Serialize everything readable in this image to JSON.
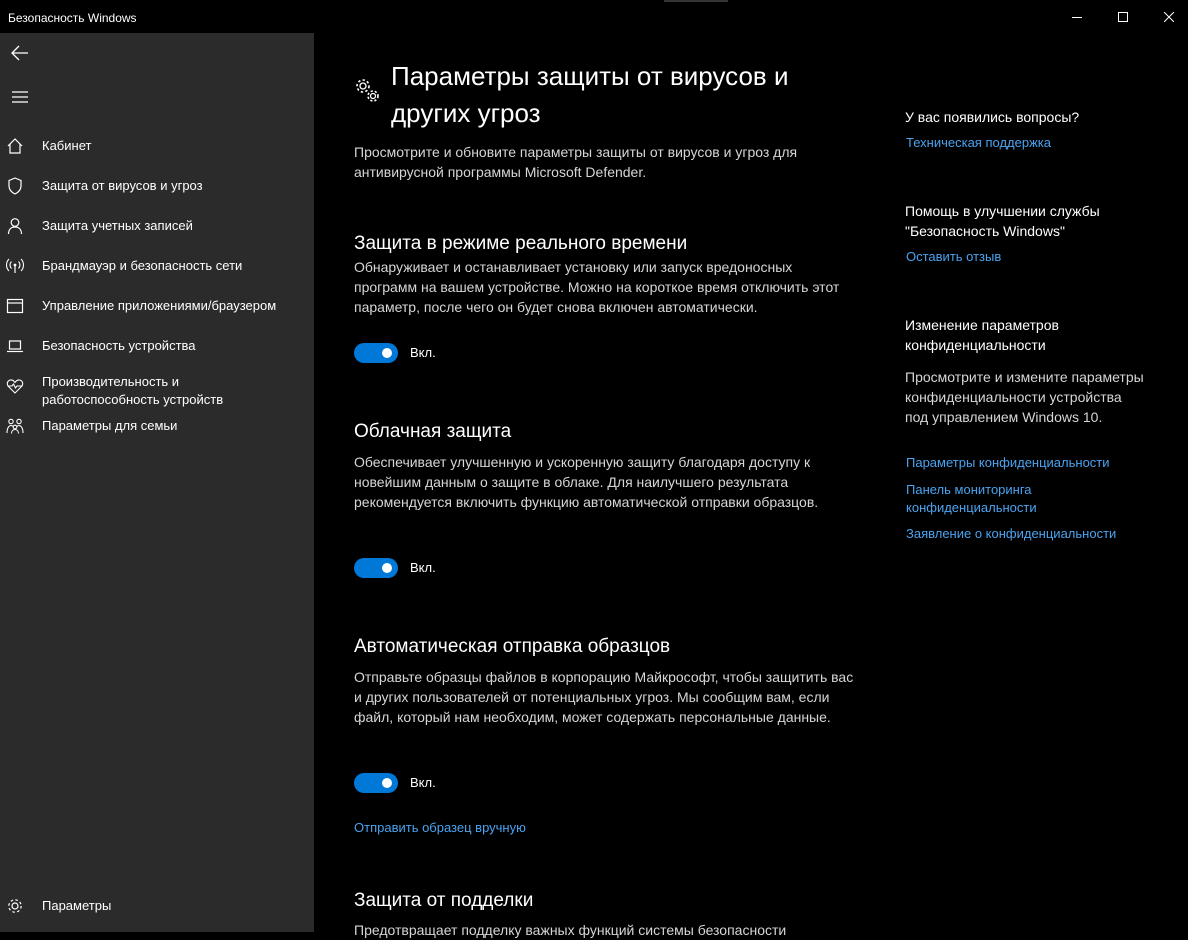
{
  "window": {
    "title": "Безопасность Windows"
  },
  "sidebar": {
    "items": [
      {
        "label": "Кабинет",
        "icon": "home-icon"
      },
      {
        "label": "Защита от вирусов и угроз",
        "icon": "shield-icon"
      },
      {
        "label": "Защита учетных записей",
        "icon": "person-icon"
      },
      {
        "label": "Брандмауэр и безопасность сети",
        "icon": "antenna-icon"
      },
      {
        "label": "Управление приложениями/браузером",
        "icon": "app-window-icon"
      },
      {
        "label": "Безопасность устройства",
        "icon": "laptop-icon"
      },
      {
        "label": "Производительность и работоспособность устройств",
        "icon": "heart-pulse-icon"
      },
      {
        "label": "Параметры для семьи",
        "icon": "family-icon"
      }
    ],
    "settings_label": "Параметры"
  },
  "main": {
    "title": "Параметры защиты от вирусов и других угроз",
    "description": "Просмотрите и обновите параметры защиты от вирусов и угроз для антивирусной программы Microsoft Defender.",
    "sections": [
      {
        "title": "Защита в режиме реального времени",
        "description": "Обнаруживает и останавливает установку или запуск вредоносных программ на вашем устройстве. Можно на короткое время отключить этот параметр, после чего он будет снова включен автоматически.",
        "toggle_label": "Вкл."
      },
      {
        "title": "Облачная защита",
        "description": "Обеспечивает улучшенную и ускоренную защиту благодаря доступу к новейшим данным о защите в облаке. Для наилучшего результата рекомендуется включить функцию автоматической отправки образцов.",
        "toggle_label": "Вкл."
      },
      {
        "title": "Автоматическая отправка образцов",
        "description": "Отправьте образцы файлов в корпорацию Майкрософт, чтобы защитить вас и других пользователей от потенциальных угроз. Мы сообщим вам, если файл, который нам необходим, может содержать персональные данные.",
        "toggle_label": "Вкл.",
        "link": "Отправить образец вручную"
      },
      {
        "title": "Защита от подделки",
        "description": "Предотвращает подделку важных функций системы безопасности"
      }
    ]
  },
  "right": {
    "questions_head": "У вас появились вопросы?",
    "support_link": "Техническая поддержка",
    "improve_head": "Помощь в улучшении службы \"Безопасность Windows\"",
    "feedback_link": "Оставить отзыв",
    "privacy_head": "Изменение параметров конфиденциальности",
    "privacy_text": "Просмотрите и измените параметры конфиденциальности устройства под управлением Windows 10.",
    "privacy_links": [
      "Параметры конфиденциальности",
      "Панель мониторинга конфиденциальности",
      "Заявление о конфиденциальности"
    ]
  },
  "colors": {
    "accent": "#0078d7",
    "link": "#4aa3f0",
    "sidebar_bg": "#2b2b2b",
    "main_bg": "#000000"
  }
}
